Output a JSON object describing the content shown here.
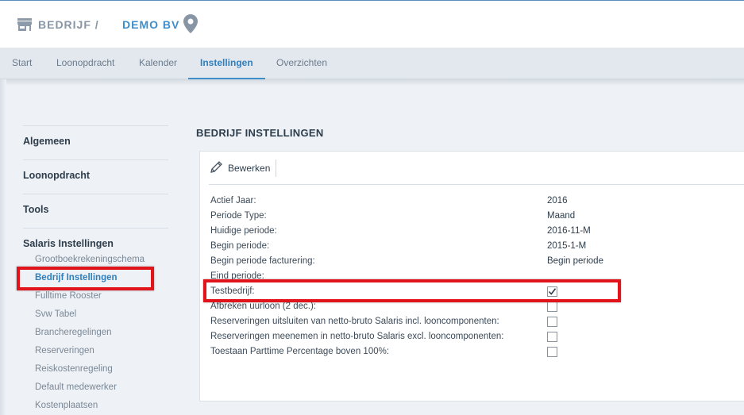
{
  "header": {
    "company_label": "BEDRIJF /",
    "company_name": "DEMO BV"
  },
  "tabs": [
    {
      "label": "Start"
    },
    {
      "label": "Loonopdracht"
    },
    {
      "label": "Kalender"
    },
    {
      "label": "Instellingen"
    },
    {
      "label": "Overzichten"
    }
  ],
  "active_tab": "Instellingen",
  "sidebar": {
    "headings": [
      "Algemeen",
      "Loonopdracht",
      "Tools",
      "Salaris Instellingen"
    ],
    "sub_items": [
      "Grootboekrekeningschema",
      "Bedrijf Instellingen",
      "Fulltime Rooster",
      "Svw Tabel",
      "Brancheregelingen",
      "Reserveringen",
      "Reiskostenregeling",
      "Default medewerker",
      "Kostenplaatsen"
    ],
    "active_item": "Bedrijf Instellingen"
  },
  "main": {
    "title": "BEDRIJF INSTELLINGEN",
    "edit_label": "Bewerken",
    "rows": [
      {
        "label": "Actief Jaar:",
        "value": "2016"
      },
      {
        "label": "Periode Type:",
        "value": "Maand"
      },
      {
        "label": "Huidige periode:",
        "value": "2016-11-M"
      },
      {
        "label": "Begin periode:",
        "value": "2015-1-M"
      },
      {
        "label": "Begin periode facturering:",
        "value": "Begin periode"
      },
      {
        "label": "Eind periode:",
        "value": ""
      },
      {
        "label": "Testbedrijf:",
        "checked": true
      },
      {
        "label": "Afbreken uurloon (2 dec.):",
        "checked": false
      },
      {
        "label": "Reserveringen uitsluiten van netto-bruto Salaris incl. looncomponenten:",
        "checked": false
      },
      {
        "label": "Reserveringen meenemen in netto-bruto Salaris excl. looncomponenten:",
        "checked": false
      },
      {
        "label": "Toestaan Parttime Percentage boven 100%:",
        "checked": false
      }
    ]
  },
  "colors": {
    "accent": "#3d8ec9",
    "annotation": "#e0141a"
  }
}
